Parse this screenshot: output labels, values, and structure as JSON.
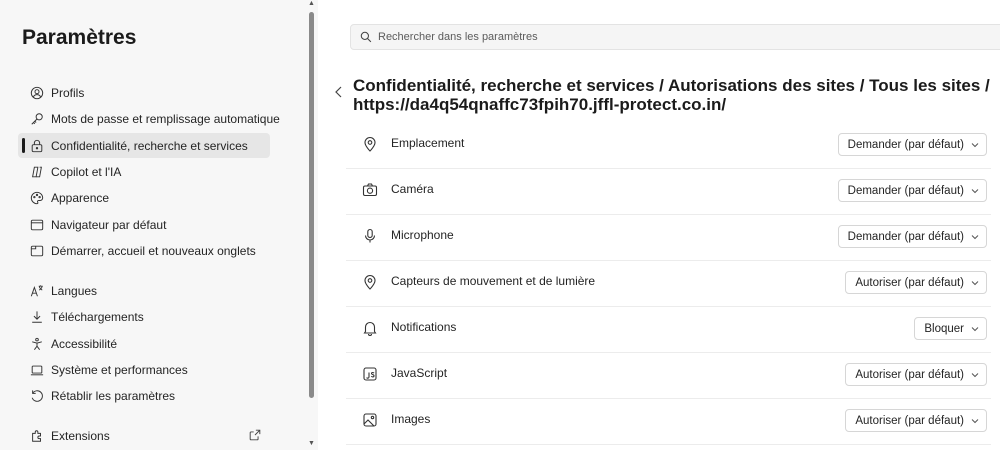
{
  "sidebar": {
    "title": "Paramètres",
    "items": [
      {
        "label": "Profils",
        "icon": "profile-icon"
      },
      {
        "label": "Mots de passe et remplissage automatique",
        "icon": "key-icon"
      },
      {
        "label": "Confidentialité, recherche et services",
        "icon": "lock-icon",
        "active": true
      },
      {
        "label": "Copilot et l'IA",
        "icon": "copilot-icon"
      },
      {
        "label": "Apparence",
        "icon": "palette-icon"
      },
      {
        "label": "Navigateur par défaut",
        "icon": "browser-icon"
      },
      {
        "label": "Démarrer, accueil et nouveaux onglets",
        "icon": "home-tab-icon"
      },
      {
        "label": "Langues",
        "icon": "languages-icon"
      },
      {
        "label": "Téléchargements",
        "icon": "download-icon"
      },
      {
        "label": "Accessibilité",
        "icon": "accessibility-icon"
      },
      {
        "label": "Système et performances",
        "icon": "laptop-icon"
      },
      {
        "label": "Rétablir les paramètres",
        "icon": "reset-icon"
      },
      {
        "label": "Extensions",
        "icon": "extensions-icon"
      }
    ]
  },
  "search": {
    "placeholder": "Rechercher dans les paramètres"
  },
  "header": {
    "breadcrumb": "Confidentialité, recherche et services / Autorisations des sites / Tous les sites / https://da4q54qnaffc73fpih70.jffl-protect.co.in/"
  },
  "permissions": [
    {
      "label": "Emplacement",
      "value": "Demander (par défaut)",
      "icon": "location-icon"
    },
    {
      "label": "Caméra",
      "value": "Demander (par défaut)",
      "icon": "camera-icon"
    },
    {
      "label": "Microphone",
      "value": "Demander (par défaut)",
      "icon": "microphone-icon"
    },
    {
      "label": "Capteurs de mouvement et de lumière",
      "value": "Autoriser (par défaut)",
      "icon": "sensor-icon"
    },
    {
      "label": "Notifications",
      "value": "Bloquer",
      "icon": "bell-icon"
    },
    {
      "label": "JavaScript",
      "value": "Autoriser (par défaut)",
      "icon": "javascript-icon"
    },
    {
      "label": "Images",
      "value": "Autoriser (par défaut)",
      "icon": "image-icon"
    }
  ]
}
